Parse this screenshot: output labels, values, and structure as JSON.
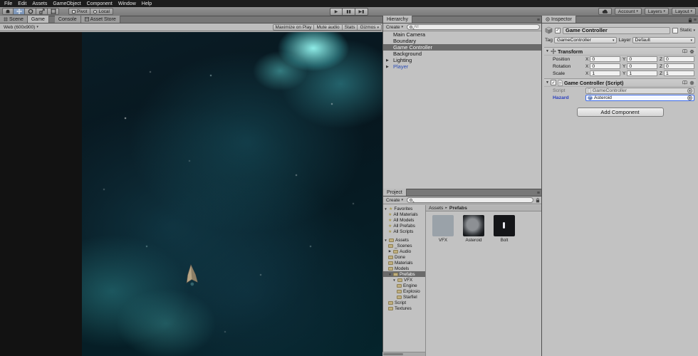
{
  "menubar": {
    "items": [
      "File",
      "Edit",
      "Assets",
      "GameObject",
      "Component",
      "Window",
      "Help"
    ]
  },
  "toolbar": {
    "pivot": "Pivot",
    "local": "Local",
    "account": "Account",
    "layers": "Layers",
    "layout": "Layout"
  },
  "view_tabs": {
    "scene": "Scene",
    "game": "Game",
    "console": "Console",
    "asset_store": "Asset Store"
  },
  "game_view": {
    "aspect": "Web (600x900)",
    "maximize": "Maximize on Play",
    "mute": "Mute audio",
    "stats": "Stats",
    "gizmos": "Gizmos"
  },
  "hierarchy": {
    "tab": "Hierarchy",
    "create": "Create",
    "search_placeholder": "All",
    "items": [
      {
        "label": "Main Camera"
      },
      {
        "label": "Boundary"
      },
      {
        "label": "Game Controller"
      },
      {
        "label": "Background"
      },
      {
        "label": "Lighting"
      },
      {
        "label": "Player"
      }
    ]
  },
  "project": {
    "tab": "Project",
    "create": "Create",
    "search_placeholder": "",
    "favorites_label": "Favorites",
    "favorites": [
      "All Materials",
      "All Models",
      "All Prefabs",
      "All Scripts"
    ],
    "assets_label": "Assets",
    "folders": [
      "_Scenes",
      "Audio",
      "Done",
      "Materials",
      "Models",
      "Prefabs",
      "VFX",
      "Engine",
      "Explosio",
      "Starfiel",
      "Script",
      "Textures"
    ],
    "breadcrumb": {
      "root": "Assets",
      "current": "Prefabs"
    },
    "items": [
      {
        "label": "VFX"
      },
      {
        "label": "Asteroid"
      },
      {
        "label": "Bolt"
      }
    ]
  },
  "inspector": {
    "tab": "Inspector",
    "name": "Game Controller",
    "static_label": "Static",
    "tag_label": "Tag",
    "tag_value": "GameController",
    "layer_label": "Layer",
    "layer_value": "Default",
    "axis": {
      "x": "X",
      "y": "Y",
      "z": "Z"
    },
    "transform": {
      "title": "Transform",
      "rows": [
        {
          "label": "Position",
          "x": "0",
          "y": "0",
          "z": "0"
        },
        {
          "label": "Rotation",
          "x": "0",
          "y": "0",
          "z": "0"
        },
        {
          "label": "Scale",
          "x": "1",
          "y": "1",
          "z": "1"
        }
      ]
    },
    "script": {
      "title": "Game Controller (Script)",
      "script_label": "Script",
      "script_value": "GameController",
      "hazard_label": "Hazard",
      "hazard_value": "Asteroid"
    },
    "add_component": "Add Component"
  },
  "icons": {
    "dropdown": "▾",
    "foldout_open": "▼",
    "foldout_closed": "▶",
    "check": "✓",
    "menu": "≡",
    "crumb_sep": "▸",
    "play": "▶",
    "pause": "▮▮",
    "step": "▶▮",
    "star": "★"
  },
  "colors": {
    "selection": "#6a6a6a",
    "prefab_text": "#2a4db5",
    "hazard_border": "#3d6be8",
    "nebula_accent": "#57d8d8"
  }
}
